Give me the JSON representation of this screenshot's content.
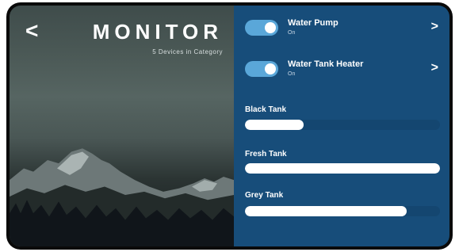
{
  "header": {
    "back_label": "<",
    "title": "MONITOR",
    "subtitle": "5 Devices in Category"
  },
  "devices": [
    {
      "name": "Water Pump",
      "status": "On",
      "enabled": true,
      "chevron": ">"
    },
    {
      "name": "Water Tank Heater",
      "status": "On",
      "enabled": true,
      "chevron": ">"
    }
  ],
  "tanks": [
    {
      "name": "Black Tank",
      "level": 0.3
    },
    {
      "name": "Fresh Tank",
      "level": 1.0
    },
    {
      "name": "Grey Tank",
      "level": 0.83
    }
  ],
  "colors": {
    "panel": "#174d7a",
    "toggle_on": "#5aa7d9",
    "bar_fill": "#ffffff"
  }
}
